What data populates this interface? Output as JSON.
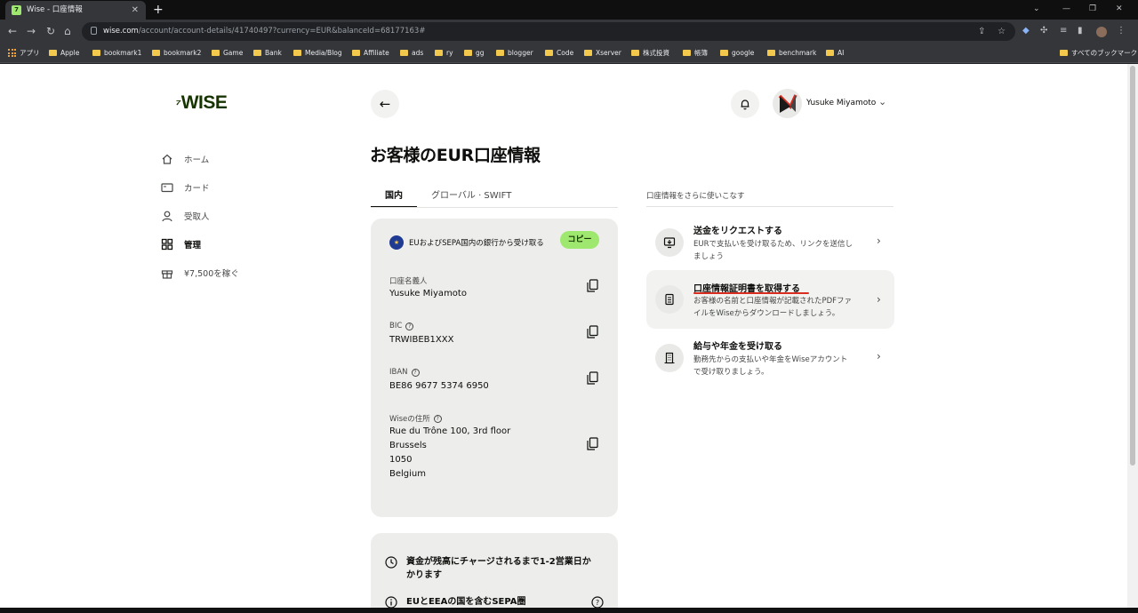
{
  "browser": {
    "tab_title": "Wise - 口座情報",
    "favicon_letter": "7",
    "url_host": "wise.com",
    "url_path": "/account/account-details/41740497?currency=EUR&balanceId=68177163#",
    "bookmarks": [
      "Apple",
      "bookmark1",
      "bookmark2",
      "Game",
      "Bank",
      "Media/Blog",
      "Affiliate",
      "ads",
      "ry",
      "gg",
      "blogger",
      "Code",
      "Xserver",
      "株式投資",
      "帳簿",
      "google",
      "benchmark",
      "AI"
    ],
    "apps_label": "アプリ",
    "all_bookmarks_label": "すべてのブックマーク"
  },
  "logo": {
    "flag": "⁷",
    "text": "WISE"
  },
  "sidebar": {
    "items": [
      {
        "label": "ホーム",
        "icon": "home-icon"
      },
      {
        "label": "カード",
        "icon": "card-icon"
      },
      {
        "label": "受取人",
        "icon": "recipients-icon"
      },
      {
        "label": "管理",
        "icon": "manage-icon",
        "active": true
      },
      {
        "label": "¥7,500を稼ぐ",
        "icon": "gift-icon"
      }
    ]
  },
  "header": {
    "user_name": "Yusuke Miyamoto"
  },
  "main": {
    "title": "お客様のEUR口座情報",
    "tabs": [
      {
        "label": "国内",
        "active": true
      },
      {
        "label": "グローバル · SWIFT"
      }
    ],
    "card": {
      "heading": "EUおよびSEPA国内の銀行から受け取る",
      "copy_label": "コピー",
      "fields": [
        {
          "label": "口座名義人",
          "value": "Yusuke Miyamoto"
        },
        {
          "label": "BIC",
          "value": "TRWIBEB1XXX"
        },
        {
          "label": "IBAN",
          "value": "BE86 9677 5374 6950"
        },
        {
          "label": "Wiseの住所",
          "value_lines": [
            "Rue du Trône 100, 3rd floor",
            "Brussels",
            "1050",
            "Belgium"
          ]
        }
      ]
    },
    "info": {
      "row1_line1": "資金が残高にチャージされるまで1-2営業日か",
      "row1_line2": "かります",
      "row2": "EUとEEAの国を含むSEPA圏"
    }
  },
  "right": {
    "heading": "口座情報をさらに使いこなす",
    "options": [
      {
        "title": "送金をリクエストする",
        "desc_line1": "EURで支払いを受け取るため、リンクを送信し",
        "desc_line2": "ましょう"
      },
      {
        "title": "口座情報証明書を取得する",
        "desc_line1": "お客様の名前と口座情報が記載されたPDFファ",
        "desc_line2": "イルをWiseからダウンロードしましょう。"
      },
      {
        "title": "給与や年金を受け取る",
        "desc_line1": "勤務先からの支払いや年金をWiseアカウント",
        "desc_line2": "で受け取りましょう。"
      }
    ]
  },
  "colors": {
    "brand_green": "#9fe870",
    "forest": "#163300",
    "card_bg": "#edeeeb",
    "highlight_red": "#d92d20"
  }
}
